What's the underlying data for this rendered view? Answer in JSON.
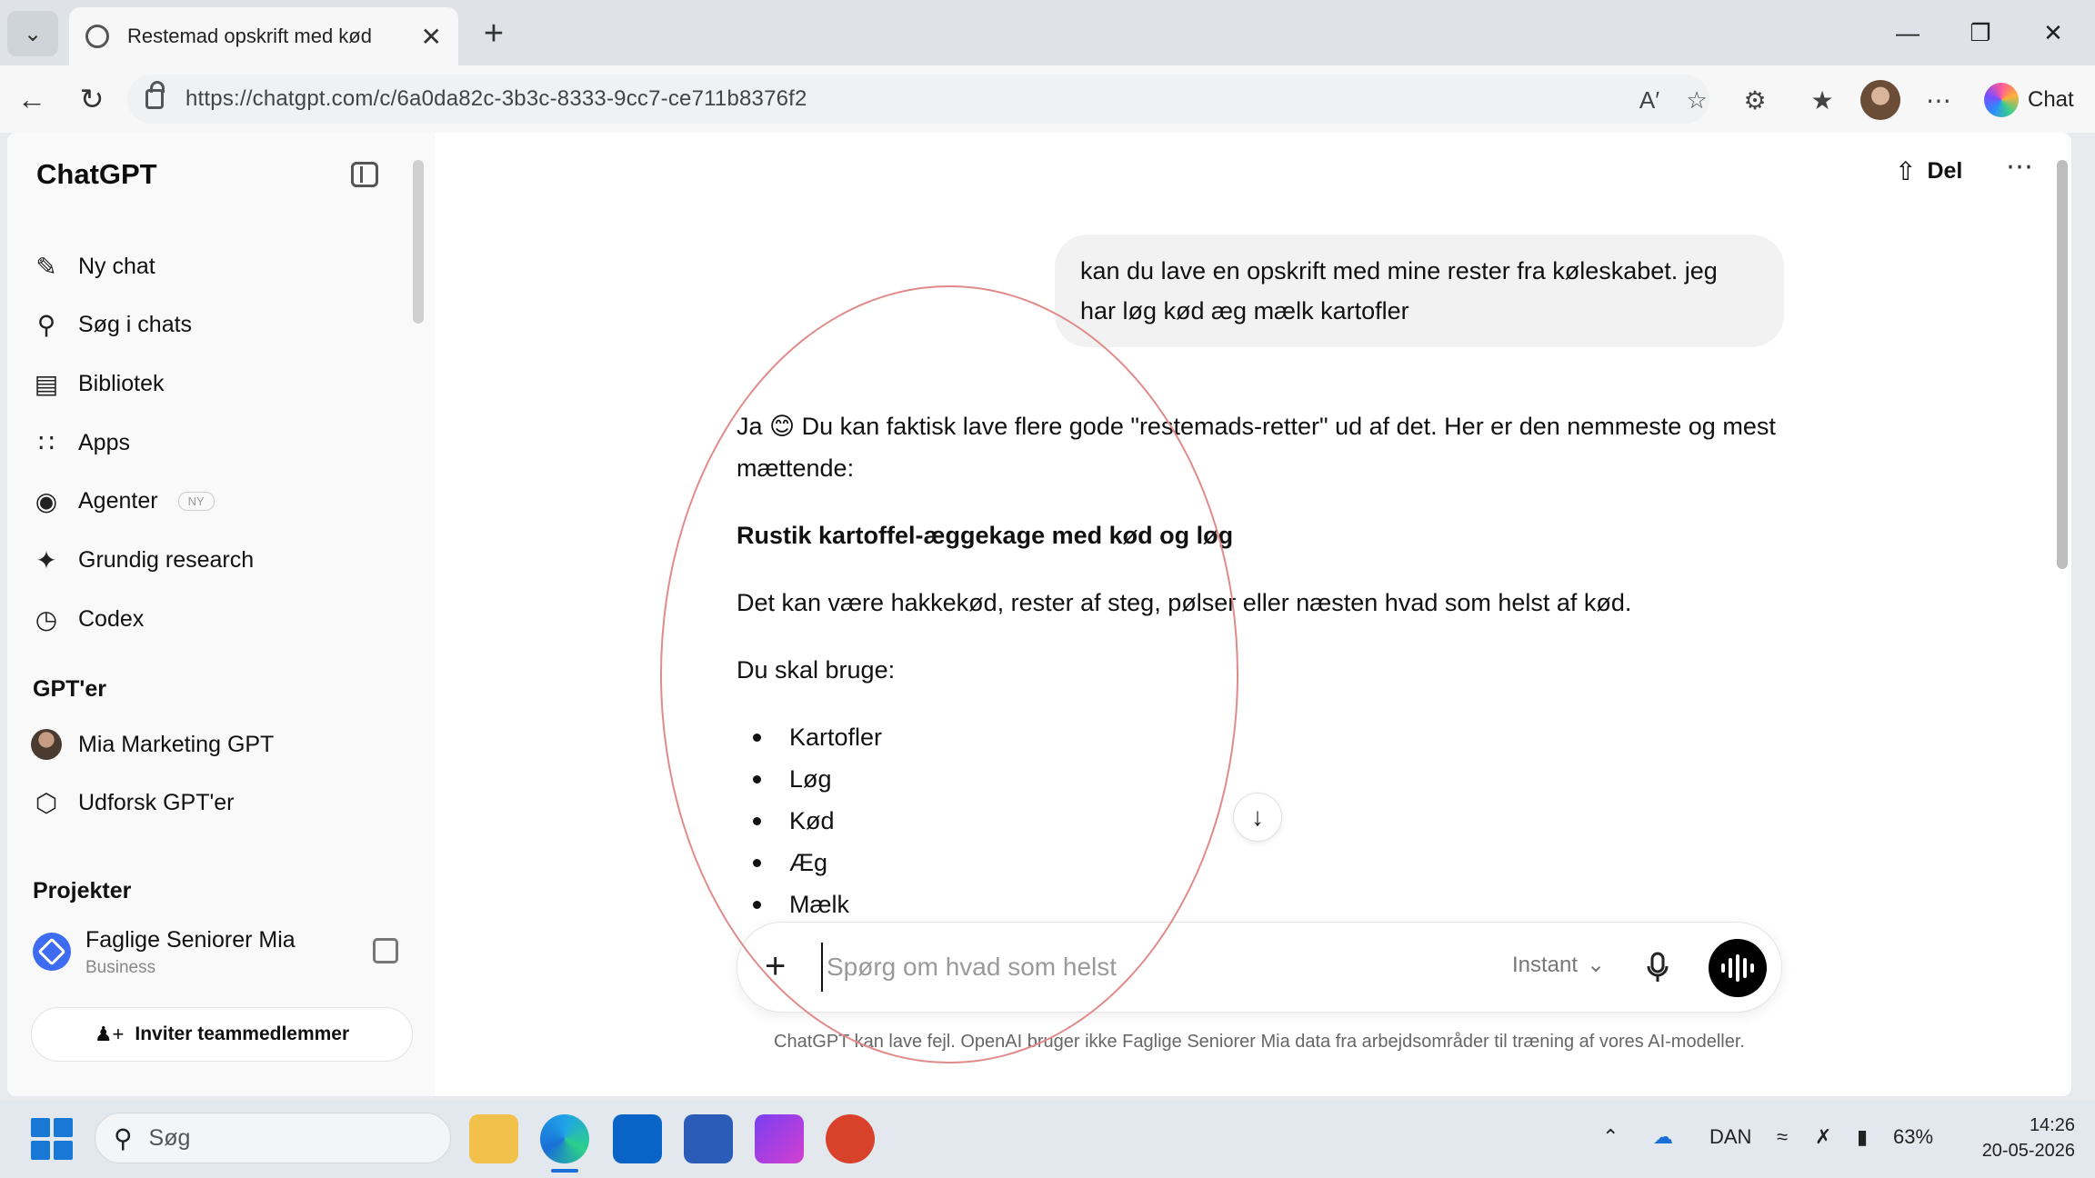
{
  "browser": {
    "tab_title": "Restemad opskrift med kød",
    "url": "https://chatgpt.com/c/6a0da82c-3b3c-8333-9cc7-ce711b8376f2",
    "copilot_label": "Chat"
  },
  "sidebar": {
    "brand": "ChatGPT",
    "items": [
      {
        "label": "Ny chat",
        "icon": "edit-icon"
      },
      {
        "label": "Søg i chats",
        "icon": "search-icon"
      },
      {
        "label": "Bibliotek",
        "icon": "library-icon"
      },
      {
        "label": "Apps",
        "icon": "apps-icon"
      },
      {
        "label": "Agenter",
        "icon": "robot-icon",
        "badge": "NY"
      },
      {
        "label": "Grundig research",
        "icon": "telescope-icon"
      },
      {
        "label": "Codex",
        "icon": "codex-icon"
      }
    ],
    "gpts_heading": "GPT'er",
    "gpts": [
      {
        "label": "Mia Marketing GPT",
        "icon": "gpt-avatar"
      },
      {
        "label": "Udforsk GPT'er",
        "icon": "cube-icon"
      }
    ],
    "projects_heading": "Projekter",
    "project": {
      "name": "Faglige Seniorer Mia",
      "subtitle": "Business"
    },
    "invite_label": "Inviter teammedlemmer"
  },
  "header": {
    "share_label": "Del"
  },
  "conversation": {
    "user_message": "kan du lave en opskrift med mine rester fra køleskabet. jeg har løg kød æg mælk kartofler",
    "intro": "Ja 😊 Du kan faktisk lave flere gode \"restemads-retter\" ud af det. Her er den nemmeste og mest mættende:",
    "recipe_title": "Rustik kartoffel-æggekage med kød og løg",
    "meat_note": "Det kan være hakkekød, rester af steg, pølser eller næsten hvad som helst af kød.",
    "ingredients_heading": "Du skal bruge:",
    "ingredients": [
      "Kartofler",
      "Løg",
      "Kød",
      "Æg",
      "Mælk"
    ]
  },
  "composer": {
    "placeholder": "Spørg om hvad som helst",
    "model": "Instant"
  },
  "disclaimer": "ChatGPT kan lave fejl. OpenAI bruger ikke Faglige Seniorer Mia data fra arbejdsområder til træning af vores AI-modeller.",
  "taskbar": {
    "search_label": "Søg",
    "language": "DAN",
    "battery": "63%",
    "time": "14:26",
    "date": "20-05-2026"
  },
  "colors": {
    "accent": "#3d6cf3",
    "annotation_ring": "#e18a8a",
    "voice_button": "#000000"
  }
}
